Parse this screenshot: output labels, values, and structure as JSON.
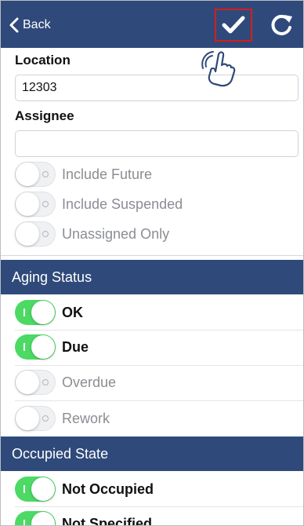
{
  "header": {
    "back_label": "Back",
    "save_icon": "checkmark-icon",
    "refresh_icon": "refresh-icon",
    "background_color": "#2f4a7a",
    "highlight_color": "#d81c1c"
  },
  "filters": {
    "location_label": "Location",
    "location_value": "12303",
    "assignee_label": "Assignee",
    "assignee_value": "",
    "toggles": [
      {
        "label": "Include Future",
        "on": false
      },
      {
        "label": "Include Suspended",
        "on": false
      },
      {
        "label": "Unassigned Only",
        "on": false
      }
    ]
  },
  "aging_status": {
    "title": "Aging Status",
    "items": [
      {
        "label": "OK",
        "on": true
      },
      {
        "label": "Due",
        "on": true
      },
      {
        "label": "Overdue",
        "on": false
      },
      {
        "label": "Rework",
        "on": false
      }
    ]
  },
  "occupied_state": {
    "title": "Occupied State",
    "items": [
      {
        "label": "Not Occupied",
        "on": true
      },
      {
        "label": "Not Specified",
        "on": true
      }
    ]
  },
  "toggle_on_color": "#4cd964"
}
